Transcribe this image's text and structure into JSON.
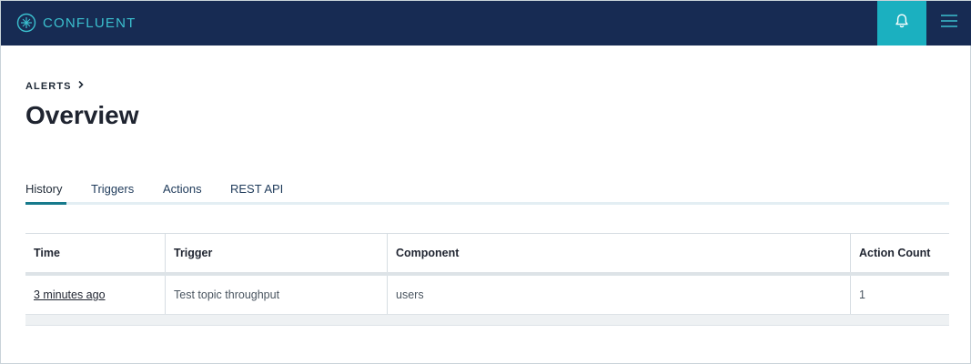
{
  "app": {
    "brand": "CONFLUENT",
    "colors": {
      "topbar": "#172b53",
      "accent": "#1bb0c0",
      "logo": "#3bc0cf"
    },
    "icons": {
      "logo": "confluent-logo-icon",
      "notifications": "bell-icon",
      "menu": "hamburger-menu-icon"
    }
  },
  "breadcrumb": {
    "items": [
      "ALERTS"
    ],
    "separator_icon": "chevron-right-icon"
  },
  "page": {
    "title": "Overview"
  },
  "tabs": [
    {
      "label": "History",
      "active": true
    },
    {
      "label": "Triggers",
      "active": false
    },
    {
      "label": "Actions",
      "active": false
    },
    {
      "label": "REST API",
      "active": false
    }
  ],
  "table": {
    "columns": [
      "Time",
      "Trigger",
      "Component",
      "Action Count"
    ],
    "rows": [
      {
        "time": "3 minutes ago",
        "trigger": "Test topic throughput",
        "component": "users",
        "action_count": "1"
      }
    ]
  }
}
